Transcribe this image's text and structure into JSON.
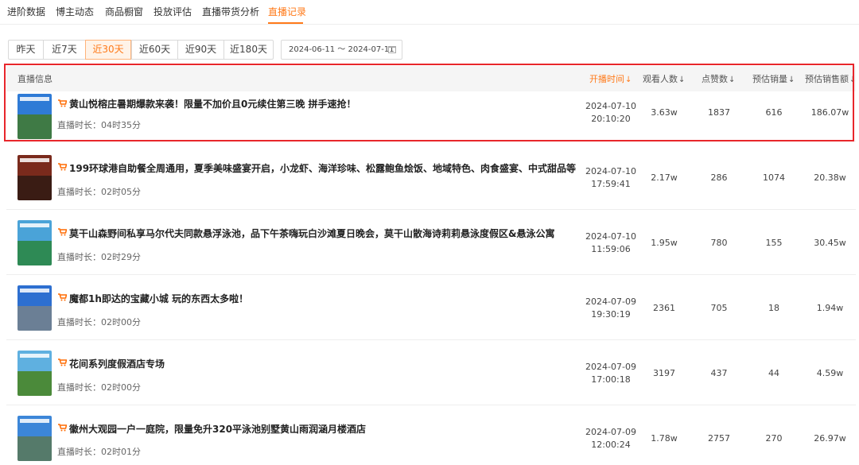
{
  "top_tabs": [
    {
      "label": "进阶数据"
    },
    {
      "label": "博主动态"
    },
    {
      "label": "商品橱窗"
    },
    {
      "label": "投放评估"
    },
    {
      "label": "直播带货分析"
    },
    {
      "label": "直播记录",
      "active": true
    }
  ],
  "filters": {
    "ranges": [
      {
        "label": "昨天"
      },
      {
        "label": "近7天"
      },
      {
        "label": "近30天",
        "active": true
      },
      {
        "label": "近60天"
      },
      {
        "label": "近90天"
      },
      {
        "label": "近180天"
      }
    ],
    "date_range": "2024-06-11 ～ 2024-07-11"
  },
  "table": {
    "headers": {
      "info": "直播信息",
      "start_time": "开播时间",
      "viewers": "观看人数",
      "likes": "点赞数",
      "sales": "预估销量",
      "amount": "预估销售额"
    },
    "sort_arrow": "↓",
    "rows": [
      {
        "title": "黄山悦榕庄暑期爆款来袭！限量不加价且0元续住第三晚 拼手速抢！",
        "duration": "直播时长：04时35分",
        "date": "2024-07-10",
        "time": "20:10:20",
        "viewers": "3.63w",
        "likes": "1837",
        "sales": "616",
        "amount": "186.07w"
      },
      {
        "title": "199环球港自助餐全周通用，夏季美味盛宴开启，小龙虾、海洋珍味、松露鲍鱼烩饭、地域特色、肉食盛宴、中式甜品等",
        "duration": "直播时长：02时05分",
        "date": "2024-07-10",
        "time": "17:59:41",
        "viewers": "2.17w",
        "likes": "286",
        "sales": "1074",
        "amount": "20.38w"
      },
      {
        "title": "莫干山森野间私享马尔代夫同款悬浮泳池，品下午茶嗨玩白沙滩夏日晚会，莫干山散海诗莉莉悬泳度假区&悬泳公寓",
        "duration": "直播时长：02时29分",
        "date": "2024-07-10",
        "time": "11:59:06",
        "viewers": "1.95w",
        "likes": "780",
        "sales": "155",
        "amount": "30.45w"
      },
      {
        "title": "魔都1h即达的宝藏小城 玩的东西太多啦！",
        "duration": "直播时长：02时00分",
        "date": "2024-07-09",
        "time": "19:30:19",
        "viewers": "2361",
        "likes": "705",
        "sales": "18",
        "amount": "1.94w"
      },
      {
        "title": "花间系列度假酒店专场",
        "duration": "直播时长：02时00分",
        "date": "2024-07-09",
        "time": "17:00:18",
        "viewers": "3197",
        "likes": "437",
        "sales": "44",
        "amount": "4.59w"
      },
      {
        "title": "徽州大观园一户一庭院，限量免升320平泳池别墅黄山雨润涵月楼酒店",
        "duration": "直播时长：02时01分",
        "date": "2024-07-09",
        "time": "12:00:24",
        "viewers": "1.78w",
        "likes": "2757",
        "sales": "270",
        "amount": "26.97w"
      }
    ]
  },
  "colors": {
    "accent": "#ff7a1a",
    "highlight_border": "#e8262b",
    "header_bg": "#f5f5f5"
  }
}
